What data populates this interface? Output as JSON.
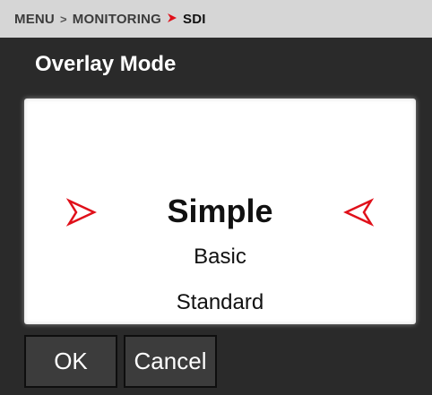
{
  "breadcrumb": {
    "items": [
      "MENU",
      "MONITORING",
      "SDI"
    ],
    "separator": ">"
  },
  "page": {
    "title": "Overlay Mode"
  },
  "picker": {
    "selected": "Simple",
    "options_below": [
      "Basic",
      "Standard"
    ],
    "left_arrow_icon": "arrow-right-outline-icon",
    "right_arrow_icon": "arrow-left-outline-icon",
    "accent_color": "#e0101a"
  },
  "buttons": {
    "ok_label": "OK",
    "cancel_label": "Cancel"
  },
  "colors": {
    "background": "#2a2a2a",
    "breadcrumb_bg": "#d6d6d6",
    "accent": "#e0101a"
  }
}
